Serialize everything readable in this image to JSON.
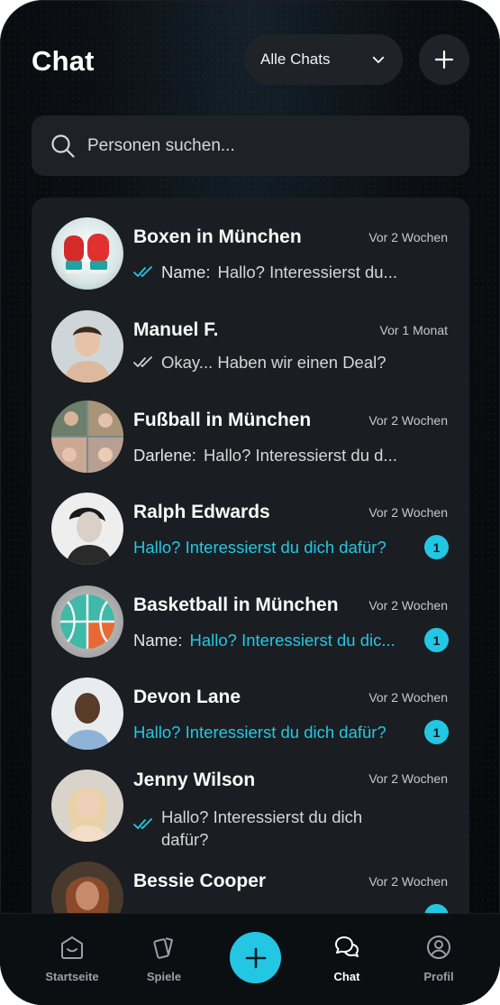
{
  "header": {
    "title": "Chat",
    "filter_label": "Alle Chats"
  },
  "search": {
    "placeholder": "Personen suchen..."
  },
  "colors": {
    "accent": "#23c7e3",
    "background": "#0b0f13",
    "card": "#1a1e22"
  },
  "chats": [
    {
      "name": "Boxen in München",
      "time": "Vor 2 Wochen",
      "prefix": "Name:",
      "message": "Hallo? Interessierst du...",
      "status": "read",
      "avatar": "boxing-gloves-icon"
    },
    {
      "name": "Manuel F.",
      "time": "Vor 1 Monat",
      "prefix": "",
      "message": "Okay... Haben wir einen Deal?",
      "status": "sent",
      "avatar": "person-photo"
    },
    {
      "name": "Fußball in München",
      "time": "Vor 2 Wochen",
      "prefix": "Darlene:",
      "message": "Hallo? Interessierst du d...",
      "status": "",
      "avatar": "group-photo"
    },
    {
      "name": "Ralph Edwards",
      "time": "Vor 2 Wochen",
      "prefix": "",
      "message": "Hallo? Interessierst du dich dafür?",
      "status": "unread",
      "badge": "1",
      "avatar": "person-photo"
    },
    {
      "name": "Basketball in München",
      "time": "Vor 2 Wochen",
      "prefix": "Name:",
      "message": "Hallo? Interessierst du dic...",
      "status": "unread",
      "badge": "1",
      "avatar": "basketball-icon"
    },
    {
      "name": "Devon Lane",
      "time": "Vor 2 Wochen",
      "prefix": "",
      "message": "Hallo? Interessierst du dich dafür?",
      "status": "unread",
      "badge": "1",
      "avatar": "person-photo"
    },
    {
      "name": "Jenny Wilson",
      "time": "Vor 2 Wochen",
      "prefix": "",
      "message": "Hallo? Interessierst du dich",
      "message_line2": "dafür?",
      "status": "read",
      "avatar": "person-photo"
    },
    {
      "name": "Bessie Cooper",
      "time": "Vor 2 Wochen",
      "prefix": "",
      "message": "",
      "status": "unread",
      "avatar": "person-photo"
    }
  ],
  "nav": [
    {
      "label": "Startseite",
      "icon": "home-icon"
    },
    {
      "label": "Spiele",
      "icon": "cards-icon"
    },
    {
      "label": "Chat",
      "icon": "chat-bubbles-icon",
      "active": true
    },
    {
      "label": "Profil",
      "icon": "profile-icon"
    }
  ]
}
